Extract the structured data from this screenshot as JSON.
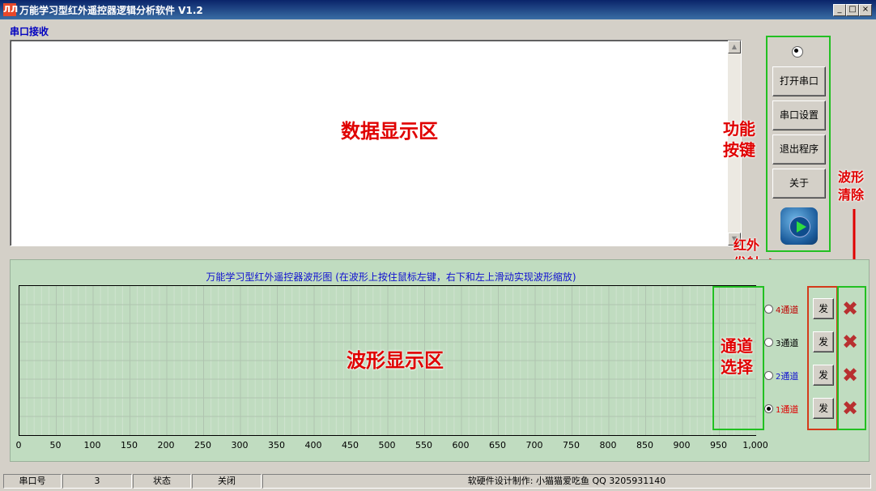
{
  "window": {
    "title": "万能学习型红外遥控器逻辑分析软件  V1.2",
    "icon_text": "ЛЛ",
    "minimize": "_",
    "maximize": "□",
    "close": "×"
  },
  "recv": {
    "label": "串口接收",
    "annotation": "数据显示区"
  },
  "buttons": {
    "open": "打开串口",
    "settings": "串口设置",
    "exit": "退出程序",
    "about": "关于"
  },
  "annotations": {
    "func_line1": "功能",
    "func_line2": "按键",
    "clear_line1": "波形",
    "clear_line2": "清除",
    "ir_line1": "红外",
    "ir_line2": "发射",
    "ch_line1": "通道",
    "ch_line2": "选择",
    "wave_area": "波形显示区"
  },
  "wave": {
    "title": "万能学习型红外遥控器波形图 (在波形上按住鼠标左键，右下和左上滑动实现波形缩放)"
  },
  "chart_data": {
    "type": "line",
    "title": "万能学习型红外遥控器波形图 (在波形上按住鼠标左键，右下和左上滑动实现波形缩放)",
    "xlabel": "",
    "ylabel": "",
    "xlim": [
      0,
      1000
    ],
    "x_ticks": [
      "0",
      "50",
      "100",
      "150",
      "200",
      "250",
      "300",
      "350",
      "400",
      "450",
      "500",
      "550",
      "600",
      "650",
      "700",
      "750",
      "800",
      "850",
      "900",
      "950",
      "1,000"
    ],
    "grid": true,
    "series": []
  },
  "channels": [
    {
      "num": "4",
      "label": "通道",
      "color": "#c00000",
      "checked": false,
      "send": "发"
    },
    {
      "num": "3",
      "label": "通道",
      "color": "#000000",
      "checked": false,
      "send": "发"
    },
    {
      "num": "2",
      "label": "通道",
      "color": "#1010d0",
      "checked": false,
      "send": "发"
    },
    {
      "num": "1",
      "label": "通道",
      "color": "#e00000",
      "checked": true,
      "send": "发"
    }
  ],
  "status": {
    "port_label": "串口号",
    "port_value": "3",
    "state_label": "状态",
    "state_value": "关闭",
    "credit": "软硬件设计制作:  小猫猫爱吃鱼 QQ 3205931140"
  }
}
